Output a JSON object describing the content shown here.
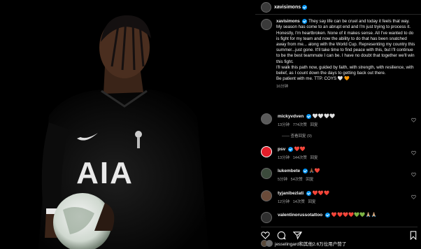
{
  "post": {
    "username": "xavisimons",
    "caption_body": "They say life can be cruel and today it feels that way. My season has come to an abrupt end and I'm just trying to process it. Honestly, I'm heartbroken. None of it makes sense. All I've wanted to do is fight for my team and now the ability to do that has been snatched away from me... along with the World Cup. Representing my country this summer...just gone. It'll take time to find peace with this, but I'll continue to be the best teammate I can be. I have no doubt that together we'll win this fight.",
    "caption_p2": "I'll walk this path now, guided by faith, with strength, with resilience, with belief, as I count down the days to getting back out there.",
    "caption_p3": "Be patient with me. TTP. COYS 🤍 🧡",
    "time": "16分钟"
  },
  "jersey_text": "AIA",
  "comments": [
    {
      "user": "mickyvdven",
      "text": "🤍🤍🤍🤍",
      "time": "13分钟",
      "likes": "774次赞",
      "reply": "回复",
      "view_replies": "—— 查看回复 (9)"
    },
    {
      "user": "psv",
      "text": "❤️❤️",
      "time": "13分钟",
      "likes": "144次赞",
      "reply": "回复"
    },
    {
      "user": "lukembete",
      "text": "🙏🏾❤️",
      "time": "5分钟",
      "likes": "54次赞",
      "reply": "回复"
    },
    {
      "user": "tyjanibezlati",
      "text": "❤️❤️❤️",
      "time": "12分钟",
      "likes": "14次赞",
      "reply": "回复"
    },
    {
      "user": "valentinorussotattoo",
      "text": "❤️❤️❤️❤️💚💚🙏🏼🙏🏼",
      "time": "",
      "likes": "",
      "reply": ""
    }
  ],
  "likes_line": {
    "text": "jesselingard和其他2.6万位用户赞了"
  },
  "colors": {
    "verified": "#0095f6",
    "heart_red": "#ed4956",
    "muted": "#a8a8a8"
  }
}
